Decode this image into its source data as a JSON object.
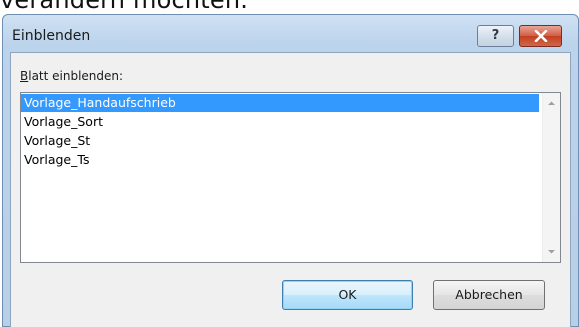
{
  "background_text": "verändern möchten.",
  "dialog": {
    "title": "Einblenden",
    "help_glyph": "?",
    "list_label_accel": "B",
    "list_label_rest": "latt einblenden:",
    "items": [
      {
        "label": "Vorlage_Handaufschrieb",
        "selected": true
      },
      {
        "label": "Vorlage_Sort",
        "selected": false
      },
      {
        "label": "Vorlage_St",
        "selected": false
      },
      {
        "label": "Vorlage_Ts",
        "selected": false
      }
    ],
    "ok_label": "OK",
    "cancel_label": "Abbrechen"
  },
  "colors": {
    "selection": "#3399ff",
    "close_button": "#c9472b",
    "title_bar": "#bcd3ec"
  },
  "icons": {
    "help": "question-mark-icon",
    "close": "close-x-icon",
    "scroll_up": "scroll-up-arrow-icon",
    "scroll_down": "scroll-down-arrow-icon"
  }
}
